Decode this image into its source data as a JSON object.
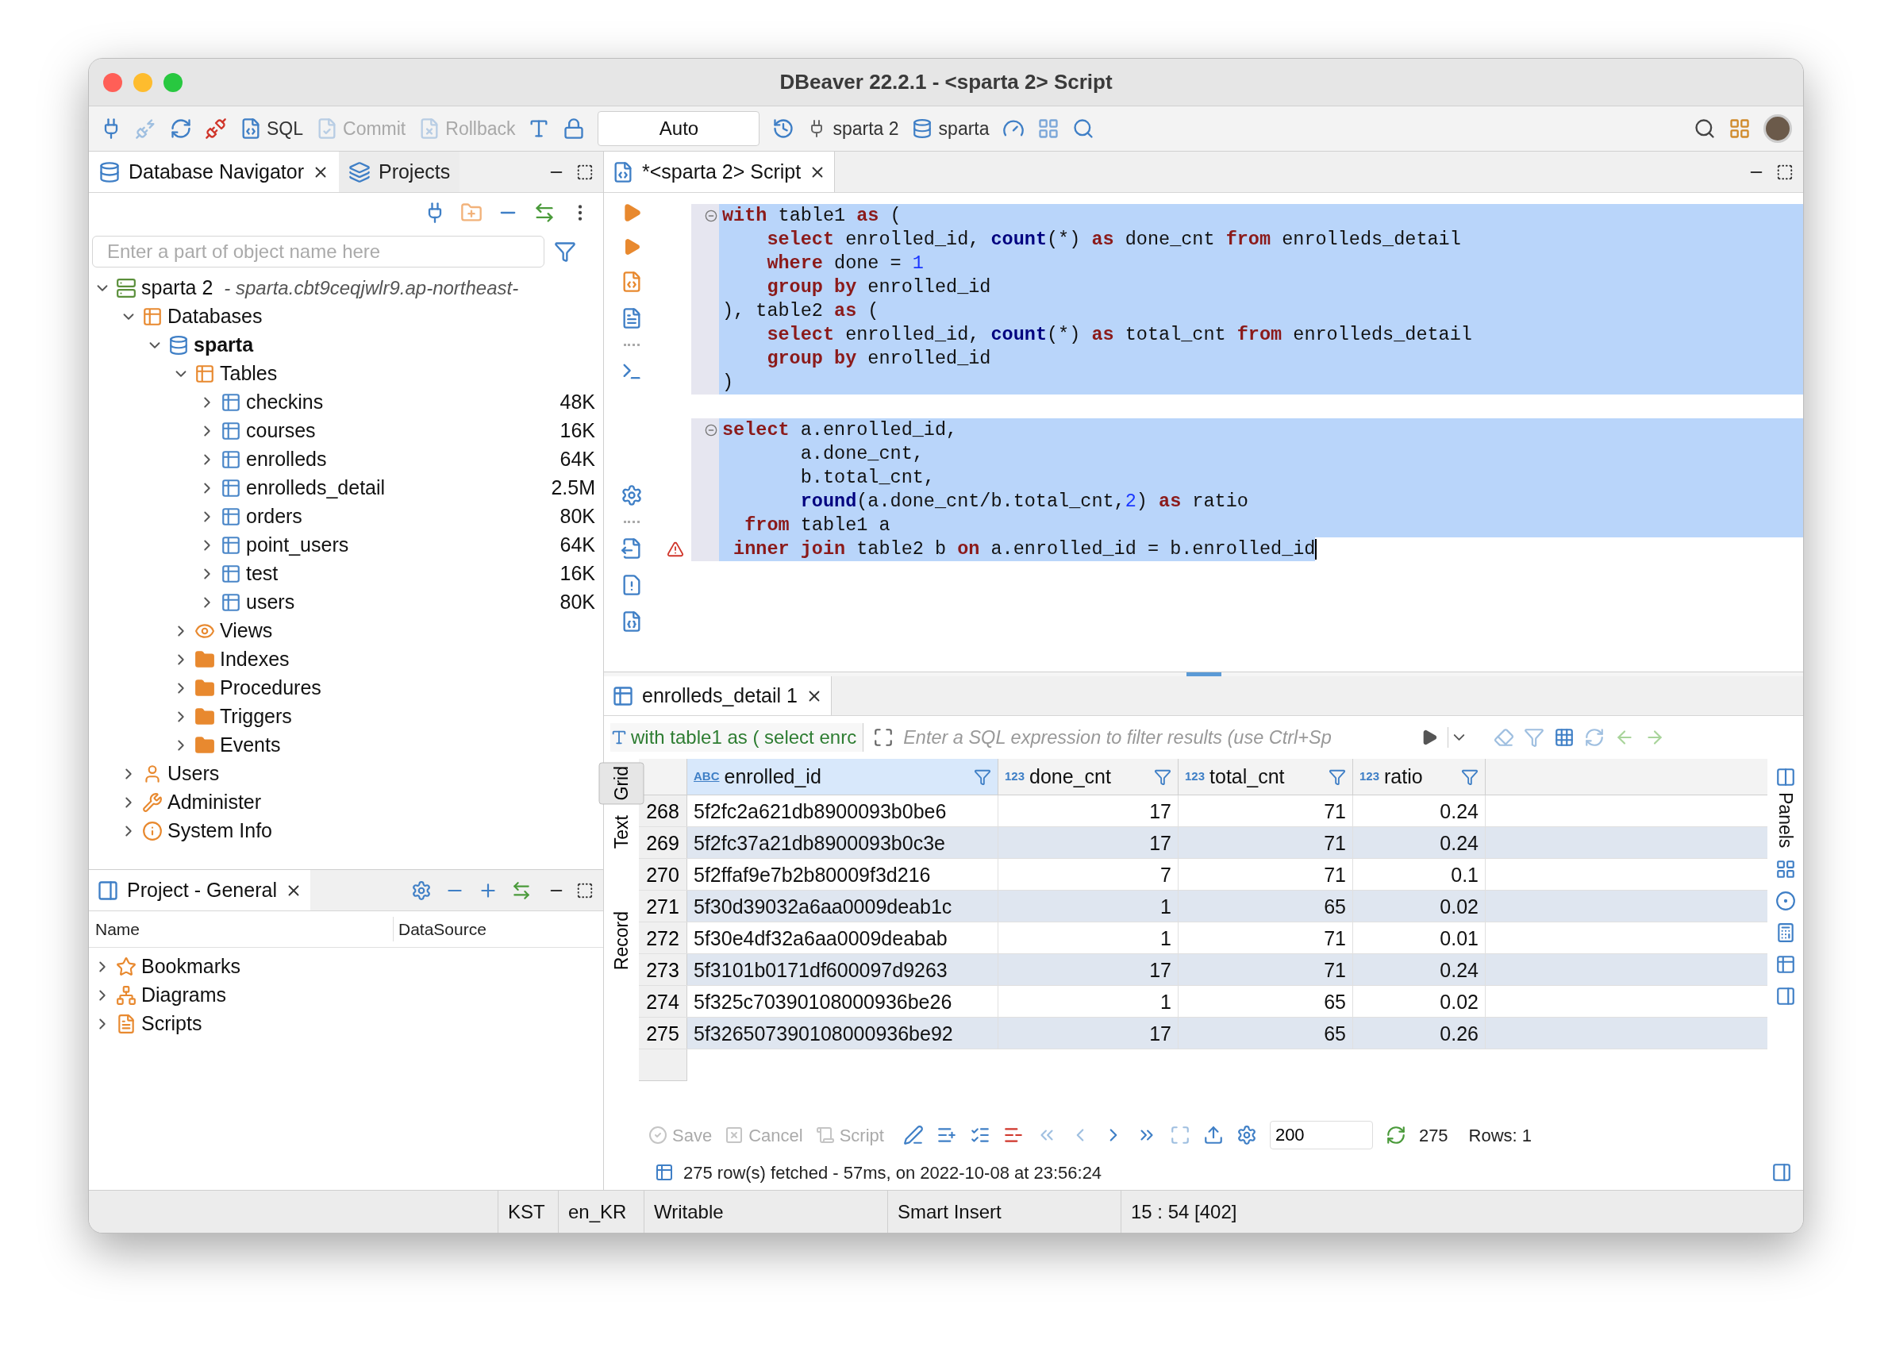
{
  "window": {
    "title": "DBeaver 22.2.1 - <sparta 2> Script"
  },
  "toolbar": {
    "sql": "SQL",
    "commit": {
      "label": "Commit",
      "disabled": true
    },
    "rollback": {
      "label": "Rollback",
      "disabled": true
    },
    "transaction_mode": "Auto",
    "connection": "sparta 2",
    "schema": "sparta"
  },
  "navigator": {
    "tabs": [
      {
        "label": "Database Navigator",
        "selected": true
      },
      {
        "label": "Projects",
        "selected": false
      }
    ],
    "filter": {
      "placeholder": "Enter a part of object name here"
    },
    "tree": [
      {
        "label": "sparta 2",
        "detail": "- sparta.cbt9ceqjwlr9.ap-northeast-",
        "kind": "connection",
        "expanded": true,
        "children": [
          {
            "label": "Databases",
            "kind": "databases",
            "expanded": true,
            "children": [
              {
                "label": "sparta",
                "kind": "database",
                "active": true,
                "expanded": true,
                "children": [
                  {
                    "label": "Tables",
                    "kind": "tables",
                    "expanded": true,
                    "children": [
                      {
                        "label": "checkins",
                        "kind": "table",
                        "size": "48K",
                        "expanded": false
                      },
                      {
                        "label": "courses",
                        "kind": "table",
                        "size": "16K",
                        "expanded": false
                      },
                      {
                        "label": "enrolleds",
                        "kind": "table",
                        "size": "64K",
                        "expanded": false
                      },
                      {
                        "label": "enrolleds_detail",
                        "kind": "table",
                        "size": "2.5M",
                        "expanded": false
                      },
                      {
                        "label": "orders",
                        "kind": "table",
                        "size": "80K",
                        "expanded": false
                      },
                      {
                        "label": "point_users",
                        "kind": "table",
                        "size": "64K",
                        "expanded": false
                      },
                      {
                        "label": "test",
                        "kind": "table",
                        "size": "16K",
                        "expanded": false
                      },
                      {
                        "label": "users",
                        "kind": "table",
                        "size": "80K",
                        "expanded": false
                      }
                    ]
                  },
                  {
                    "label": "Views",
                    "kind": "views",
                    "expanded": false
                  },
                  {
                    "label": "Indexes",
                    "kind": "folder",
                    "expanded": false
                  },
                  {
                    "label": "Procedures",
                    "kind": "folder",
                    "expanded": false
                  },
                  {
                    "label": "Triggers",
                    "kind": "folder",
                    "expanded": false
                  },
                  {
                    "label": "Events",
                    "kind": "folder",
                    "expanded": false
                  }
                ]
              }
            ]
          },
          {
            "label": "Users",
            "kind": "users",
            "expanded": false
          },
          {
            "label": "Administer",
            "kind": "administer",
            "expanded": false
          },
          {
            "label": "System Info",
            "kind": "info",
            "expanded": false
          }
        ]
      }
    ]
  },
  "project": {
    "title": "Project - General",
    "columns": [
      "Name",
      "DataSource"
    ],
    "items": [
      {
        "label": "Bookmarks",
        "kind": "bookmarks",
        "expanded": false
      },
      {
        "label": "Diagrams",
        "kind": "diagrams",
        "expanded": false
      },
      {
        "label": "Scripts",
        "kind": "scripts",
        "expanded": false
      }
    ]
  },
  "editor": {
    "tab": {
      "label": "*<sparta 2> Script",
      "selected": true
    },
    "selected": true,
    "statements": [
      {
        "lines": [
          {
            "warning": false,
            "tokens": [
              {
                "kind": "keyword",
                "text": "with"
              },
              {
                "kind": "plain",
                "text": " table1 "
              },
              {
                "kind": "keyword",
                "text": "as"
              },
              {
                "kind": "plain",
                "text": " ("
              }
            ]
          },
          {
            "warning": false,
            "tokens": [
              {
                "kind": "keyword",
                "text": "    select"
              },
              {
                "kind": "plain",
                "text": " enrolled_id, "
              },
              {
                "kind": "function",
                "text": "count"
              },
              {
                "kind": "plain",
                "text": "(*) "
              },
              {
                "kind": "keyword",
                "text": "as"
              },
              {
                "kind": "plain",
                "text": " done_cnt "
              },
              {
                "kind": "keyword",
                "text": "from"
              },
              {
                "kind": "plain",
                "text": " enrolleds_detail"
              }
            ]
          },
          {
            "warning": false,
            "tokens": [
              {
                "kind": "keyword",
                "text": "    where"
              },
              {
                "kind": "plain",
                "text": " done = "
              },
              {
                "kind": "number",
                "text": "1"
              }
            ]
          },
          {
            "warning": false,
            "tokens": [
              {
                "kind": "keyword",
                "text": "    group by"
              },
              {
                "kind": "plain",
                "text": " enrolled_id"
              }
            ]
          },
          {
            "warning": false,
            "tokens": [
              {
                "kind": "plain",
                "text": "), table2 "
              },
              {
                "kind": "keyword",
                "text": "as"
              },
              {
                "kind": "plain",
                "text": " ("
              }
            ]
          },
          {
            "warning": false,
            "tokens": [
              {
                "kind": "keyword",
                "text": "    select"
              },
              {
                "kind": "plain",
                "text": " enrolled_id, "
              },
              {
                "kind": "function",
                "text": "count"
              },
              {
                "kind": "plain",
                "text": "(*) "
              },
              {
                "kind": "keyword",
                "text": "as"
              },
              {
                "kind": "plain",
                "text": " total_cnt "
              },
              {
                "kind": "keyword",
                "text": "from"
              },
              {
                "kind": "plain",
                "text": " enrolleds_detail"
              }
            ]
          },
          {
            "warning": false,
            "tokens": [
              {
                "kind": "keyword",
                "text": "    group by"
              },
              {
                "kind": "plain",
                "text": " enrolled_id"
              }
            ]
          },
          {
            "warning": false,
            "tokens": [
              {
                "kind": "plain",
                "text": ")"
              }
            ]
          }
        ]
      },
      {
        "lines": [
          {
            "warning": false,
            "tokens": [
              {
                "kind": "keyword",
                "text": "select"
              },
              {
                "kind": "plain",
                "text": " a.enrolled_id,"
              }
            ]
          },
          {
            "warning": false,
            "tokens": [
              {
                "kind": "plain",
                "text": "       a.done_cnt,"
              }
            ]
          },
          {
            "warning": false,
            "tokens": [
              {
                "kind": "plain",
                "text": "       b.total_cnt,"
              }
            ]
          },
          {
            "warning": false,
            "tokens": [
              {
                "kind": "function",
                "text": "       round"
              },
              {
                "kind": "plain",
                "text": "(a.done_cnt/b.total_cnt,"
              },
              {
                "kind": "number",
                "text": "2"
              },
              {
                "kind": "plain",
                "text": ") "
              },
              {
                "kind": "keyword",
                "text": "as"
              },
              {
                "kind": "plain",
                "text": " ratio"
              }
            ]
          },
          {
            "warning": false,
            "tokens": [
              {
                "kind": "keyword",
                "text": "  from"
              },
              {
                "kind": "plain",
                "text": " table1 a"
              }
            ]
          },
          {
            "warning": true,
            "tokens": [
              {
                "kind": "keyword",
                "text": " inner join"
              },
              {
                "kind": "plain",
                "text": " table2 b "
              },
              {
                "kind": "keyword",
                "text": "on"
              },
              {
                "kind": "plain",
                "text": " a.enrolled_id = b.enrolled_id"
              }
            ]
          }
        ]
      }
    ]
  },
  "results": {
    "tab": {
      "label": "enrolleds_detail 1",
      "selected": true
    },
    "query_chip": "with table1 as ( select enrc",
    "filter": {
      "placeholder": "Enter a SQL expression to filter results (use Ctrl+Sp"
    },
    "side_tabs": [
      {
        "label": "Grid",
        "selected": true
      },
      {
        "label": "Text",
        "selected": false
      },
      {
        "label": "Record",
        "selected": false
      }
    ],
    "columns": [
      {
        "name": "enrolled_id",
        "type_label": "ABC",
        "kind": "text",
        "selected": true
      },
      {
        "name": "done_cnt",
        "type_label": "123",
        "kind": "number",
        "selected": false
      },
      {
        "name": "total_cnt",
        "type_label": "123",
        "kind": "number",
        "selected": false
      },
      {
        "name": "ratio",
        "type_label": "123",
        "kind": "number",
        "selected": false
      }
    ],
    "rows": [
      {
        "num": "268",
        "cells": [
          "5f2fc2a621db8900093b0be6",
          "17",
          "71",
          "0.24"
        ]
      },
      {
        "num": "269",
        "cells": [
          "5f2fc37a21db8900093b0c3e",
          "17",
          "71",
          "0.24"
        ]
      },
      {
        "num": "270",
        "cells": [
          "5f2ffaf9e7b2b80009f3d216",
          "7",
          "71",
          "0.1"
        ]
      },
      {
        "num": "271",
        "cells": [
          "5f30d39032a6aa0009deab1c",
          "1",
          "65",
          "0.02"
        ]
      },
      {
        "num": "272",
        "cells": [
          "5f30e4df32a6aa0009deabab",
          "1",
          "71",
          "0.01"
        ]
      },
      {
        "num": "273",
        "cells": [
          "5f3101b0171df600097d9263",
          "17",
          "71",
          "0.24"
        ]
      },
      {
        "num": "274",
        "cells": [
          "5f325c70390108000936be26",
          "1",
          "65",
          "0.02"
        ]
      },
      {
        "num": "275",
        "cells": [
          "5f326507390108000936be92",
          "17",
          "65",
          "0.26"
        ]
      }
    ],
    "panels_label": "Panels",
    "actions": [
      {
        "label": "Save",
        "disabled": true
      },
      {
        "label": "Cancel",
        "disabled": true
      },
      {
        "label": "Script",
        "disabled": true
      }
    ],
    "fetch_size": "200",
    "row_count": "275",
    "rows_selected": "Rows: 1",
    "status_message": "275 row(s) fetched - 57ms, on 2022-10-08 at 23:56:24"
  },
  "status_bar": [
    "KST",
    "en_KR",
    "Writable",
    "Smart Insert",
    "15 : 54 [402]"
  ]
}
